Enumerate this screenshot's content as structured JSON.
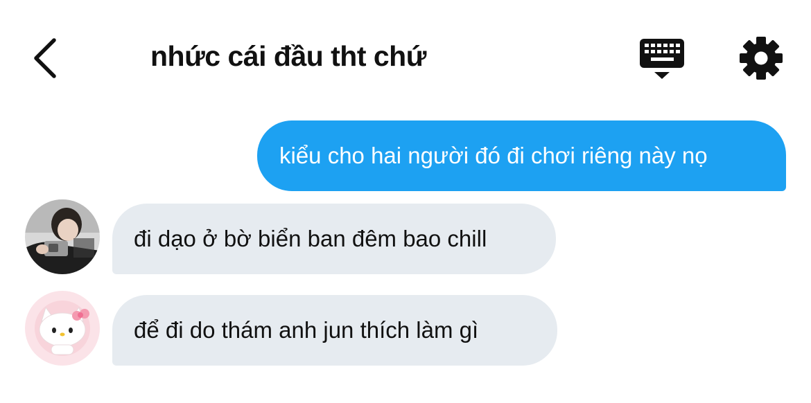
{
  "header": {
    "title": "nhức cái đầu tht chứ",
    "back_icon": "chevron-left-icon",
    "keyboard_icon": "keyboard-icon",
    "settings_icon": "gear-icon"
  },
  "messages": [
    {
      "direction": "outgoing",
      "text": "kiểu cho hai người đó đi chơi riêng này nọ"
    },
    {
      "direction": "incoming",
      "text": "đi dạo ở bờ biển ban đêm bao chill",
      "avatar": "avatar-photo-person"
    },
    {
      "direction": "incoming",
      "text": "để đi do thám anh jun thích làm gì",
      "avatar": "avatar-hello-kitty"
    }
  ],
  "colors": {
    "outgoing_bubble": "#1da1f2",
    "incoming_bubble": "#e6ebf0",
    "text": "#111111"
  }
}
